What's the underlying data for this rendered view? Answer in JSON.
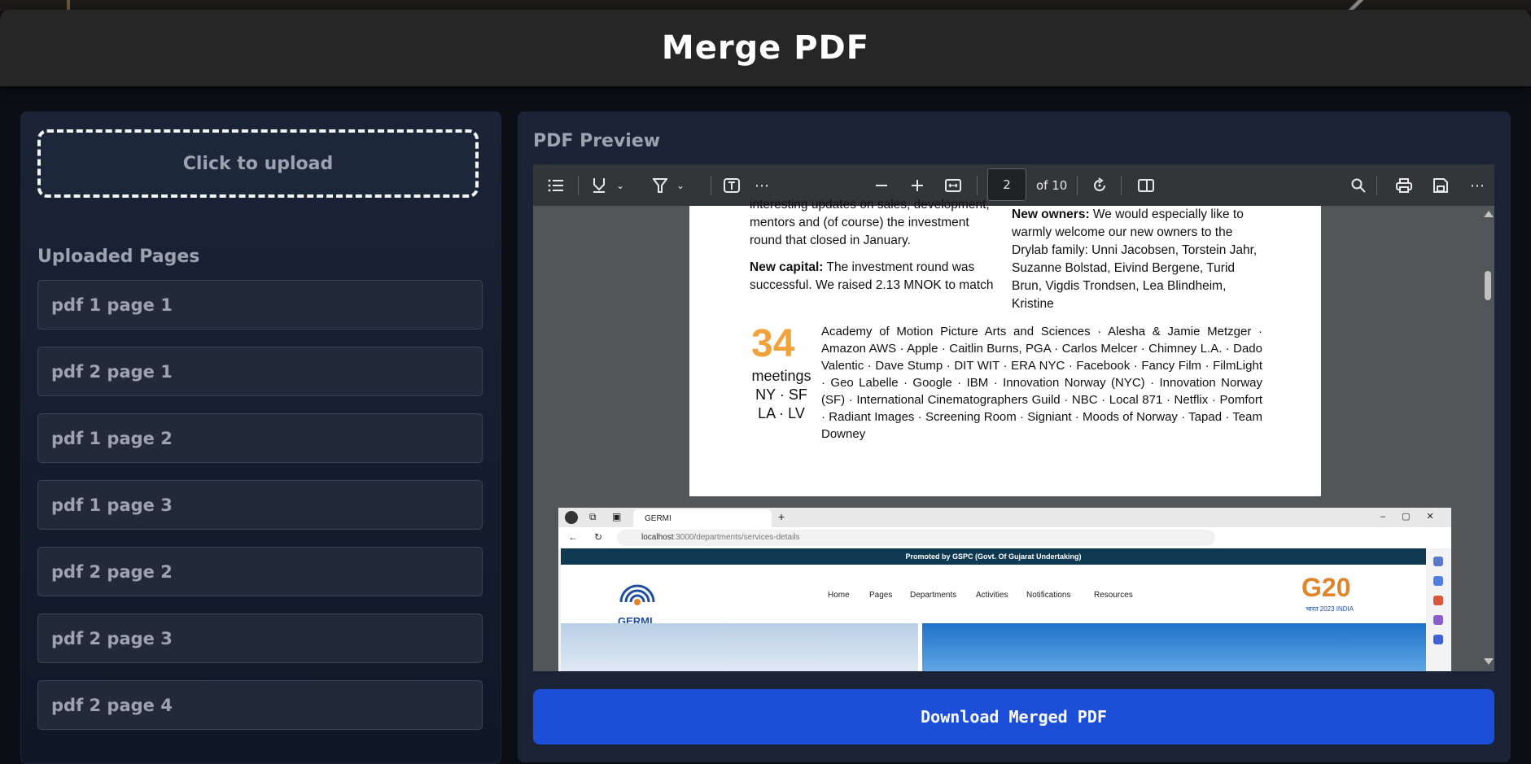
{
  "header": {
    "title": "Merge PDF"
  },
  "upload": {
    "label": "Click to upload"
  },
  "uploaded": {
    "title": "Uploaded Pages",
    "items": [
      "pdf 1 page 1",
      "pdf 2 page 1",
      "pdf 1 page 2",
      "pdf 1 page 3",
      "pdf 2 page 2",
      "pdf 2 page 3",
      "pdf 2 page 4"
    ]
  },
  "preview": {
    "title": "PDF Preview",
    "toolbar": {
      "page_current": "2",
      "page_total": "of 10",
      "icons": [
        "contents-icon",
        "draw-icon",
        "highlight-icon",
        "text-icon",
        "more-tools-icon",
        "zoom-out-icon",
        "zoom-in-icon",
        "fit-page-icon",
        "rotate-icon",
        "two-page-icon",
        "search-icon",
        "print-icon",
        "save-icon",
        "more-icon"
      ]
    },
    "page1": {
      "left_col": "interesting updates on sales, development, mentors and (of course) the investment round that closed in January.",
      "capital_label": "New capital:",
      "capital_text": " The investment round was successful. We raised 2.13 MNOK to match",
      "owners_label": "New owners:",
      "owners_text": " We would especially like to warmly welcome our new owners to the Drylab family: Unni Jacobsen, Torstein Jahr, Suzanne Bolstad, Eivind Bergene, Turid Brun, Vigdis Trondsen, Lea Blindheim, Kristine",
      "big_number": "34",
      "meetings_label": "meetings",
      "meetings_cities_1": "NY · SF",
      "meetings_cities_2": "LA · LV",
      "sponsors": "Academy of Motion Picture Arts and Sciences · Alesha & Jamie Metzger · Amazon AWS · Apple · Caitlin Burns, PGA · Carlos Melcer · Chimney L.A. · Dado Valentic · Dave Stump · DIT WIT · ERA NYC · Facebook · Fancy Film · FilmLight · Geo Labelle · Google · IBM · Innovation Norway (NYC) · Innovation Norway (SF) · International Cinematographers Guild · NBC · Local 871 · Netflix · Pomfort · Radiant Images · Screening Room · Signiant · Moods of Norway · Tapad · Team Downey"
    },
    "page2": {
      "tab_title": "GERMI",
      "url_host": "localhost",
      "url_path": ":3000/departments/services-details",
      "promo": "Promoted by GSPC (Govt. Of Gujarat Undertaking)",
      "logo_text": "GERMI",
      "nav": [
        "Home",
        "Pages",
        "Departments",
        "Activities",
        "Notifications",
        "Resources"
      ],
      "g20_main": "G20",
      "g20_sub": "भारत 2023 INDIA"
    }
  },
  "download": {
    "label": "Download Merged PDF"
  }
}
